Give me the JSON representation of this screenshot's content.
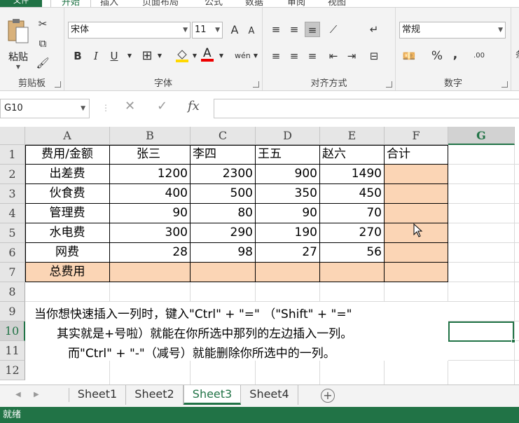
{
  "ribbon_tabs": [
    "文件",
    "开始",
    "插入",
    "页面布局",
    "公式",
    "数据",
    "审阅",
    "视图"
  ],
  "clipboard": {
    "paste_label": "粘贴",
    "group_label": "剪贴板"
  },
  "font": {
    "name": "宋体",
    "size": "11",
    "group_label": "字体",
    "bold": "B",
    "italic": "I",
    "underline": "U",
    "grow": "A",
    "shrink": "A"
  },
  "alignment": {
    "group_label": "对齐方式"
  },
  "number": {
    "format": "常规",
    "group_label": "数字",
    "percent": "%",
    "comma": ","
  },
  "formula_bar": {
    "name_box": "G10",
    "fx": "fx",
    "cancel": "✕",
    "confirm": "✓",
    "formula": ""
  },
  "columns": [
    "A",
    "B",
    "C",
    "D",
    "E",
    "F",
    "G"
  ],
  "rows": [
    "1",
    "2",
    "3",
    "4",
    "5",
    "6",
    "7",
    "8",
    "9",
    "10",
    "11",
    "12"
  ],
  "table": {
    "header": [
      "费用/金额",
      "张三",
      "李四",
      "王五",
      "赵六",
      "合计"
    ],
    "body": [
      [
        "出差费",
        "1200",
        "2300",
        "900",
        "1490",
        ""
      ],
      [
        "伙食费",
        "400",
        "500",
        "350",
        "450",
        ""
      ],
      [
        "管理费",
        "90",
        "80",
        "90",
        "70",
        ""
      ],
      [
        "水电费",
        "300",
        "290",
        "190",
        "270",
        ""
      ],
      [
        "网费",
        "28",
        "98",
        "27",
        "56",
        ""
      ]
    ],
    "total_label": "总费用"
  },
  "note": [
    "当你想快速插入一列时，键入\"Ctrl\" + \"=\" （\"Shift\" + \"=\"",
    "其实就是+号啦）就能在你所选中那列的左边插入一列。",
    "而\"Ctrl\" + \"-\"（减号）就能删除你所选中的一列。"
  ],
  "sheets": [
    "Sheet1",
    "Sheet2",
    "Sheet3",
    "Sheet4"
  ],
  "active_sheet": "Sheet3",
  "status": "就绪",
  "colors": {
    "accent": "#217346",
    "highlight": "#fbd5b5"
  }
}
